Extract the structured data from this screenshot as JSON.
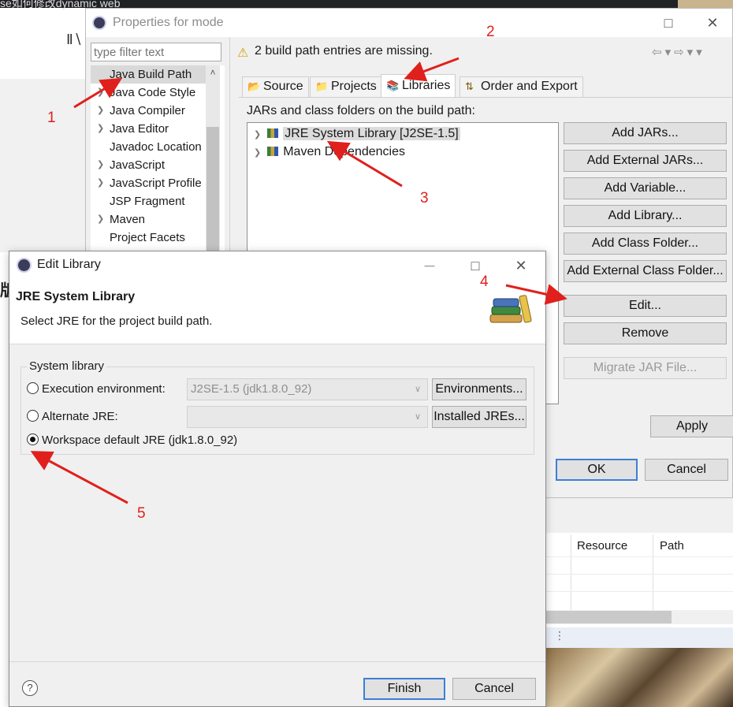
{
  "background": {
    "browser_tab_text": "se如何修改dynamic web",
    "side_char": "版",
    "panel": {
      "columns": [
        "Resource",
        "Path"
      ]
    }
  },
  "properties_dialog": {
    "title": "Properties for mode",
    "filter_placeholder": "type filter text",
    "nav_items": [
      {
        "label": "Java Build Path",
        "has_children": false,
        "selected": true
      },
      {
        "label": "Java Code Style",
        "has_children": true,
        "selected": false
      },
      {
        "label": "Java Compiler",
        "has_children": true,
        "selected": false
      },
      {
        "label": "Java Editor",
        "has_children": true,
        "selected": false
      },
      {
        "label": "Javadoc Location",
        "has_children": false,
        "selected": false
      },
      {
        "label": "JavaScript",
        "has_children": true,
        "selected": false
      },
      {
        "label": "JavaScript Profile",
        "has_children": true,
        "selected": false
      },
      {
        "label": "JSP Fragment",
        "has_children": false,
        "selected": false
      },
      {
        "label": "Maven",
        "has_children": true,
        "selected": false
      },
      {
        "label": "Project Facets",
        "has_children": false,
        "selected": false
      }
    ],
    "warning": "2 build path entries are missing.",
    "tabs": [
      {
        "label": "Source",
        "active": false
      },
      {
        "label": "Projects",
        "active": false
      },
      {
        "label": "Libraries",
        "active": true
      },
      {
        "label": "Order and Export",
        "active": false
      }
    ],
    "jars_label": "JARs and class folders on the build path:",
    "libraries": [
      {
        "label": "JRE System Library [J2SE-1.5]",
        "selected": true
      },
      {
        "label": "Maven Dependencies",
        "selected": false
      }
    ],
    "buttons": {
      "add_jars": "Add JARs...",
      "add_external_jars": "Add External JARs...",
      "add_variable": "Add Variable...",
      "add_library": "Add Library...",
      "add_class_folder": "Add Class Folder...",
      "add_external_class_folder": "Add External Class Folder...",
      "edit": "Edit...",
      "remove": "Remove",
      "migrate_jar": "Migrate JAR File...",
      "apply": "Apply",
      "ok": "OK",
      "cancel": "Cancel"
    }
  },
  "edit_library_dialog": {
    "title": "Edit Library",
    "heading": "JRE System Library",
    "description": "Select JRE for the project build path.",
    "group_label": "System library",
    "options": {
      "execution_env": {
        "label": "Execution environment:",
        "value": "J2SE-1.5 (jdk1.8.0_92)",
        "button": "Environments...",
        "checked": false
      },
      "alternate_jre": {
        "label": "Alternate JRE:",
        "value": "",
        "button": "Installed JREs...",
        "checked": false
      },
      "workspace_default": {
        "label": "Workspace default JRE (jdk1.8.0_92)",
        "checked": true
      }
    },
    "buttons": {
      "finish": "Finish",
      "cancel": "Cancel"
    },
    "help": "?"
  },
  "annotations": [
    "1",
    "2",
    "3",
    "4",
    "5"
  ],
  "colors": {
    "annotation": "#e0201c",
    "default_button_border": "#3c7fd6"
  }
}
